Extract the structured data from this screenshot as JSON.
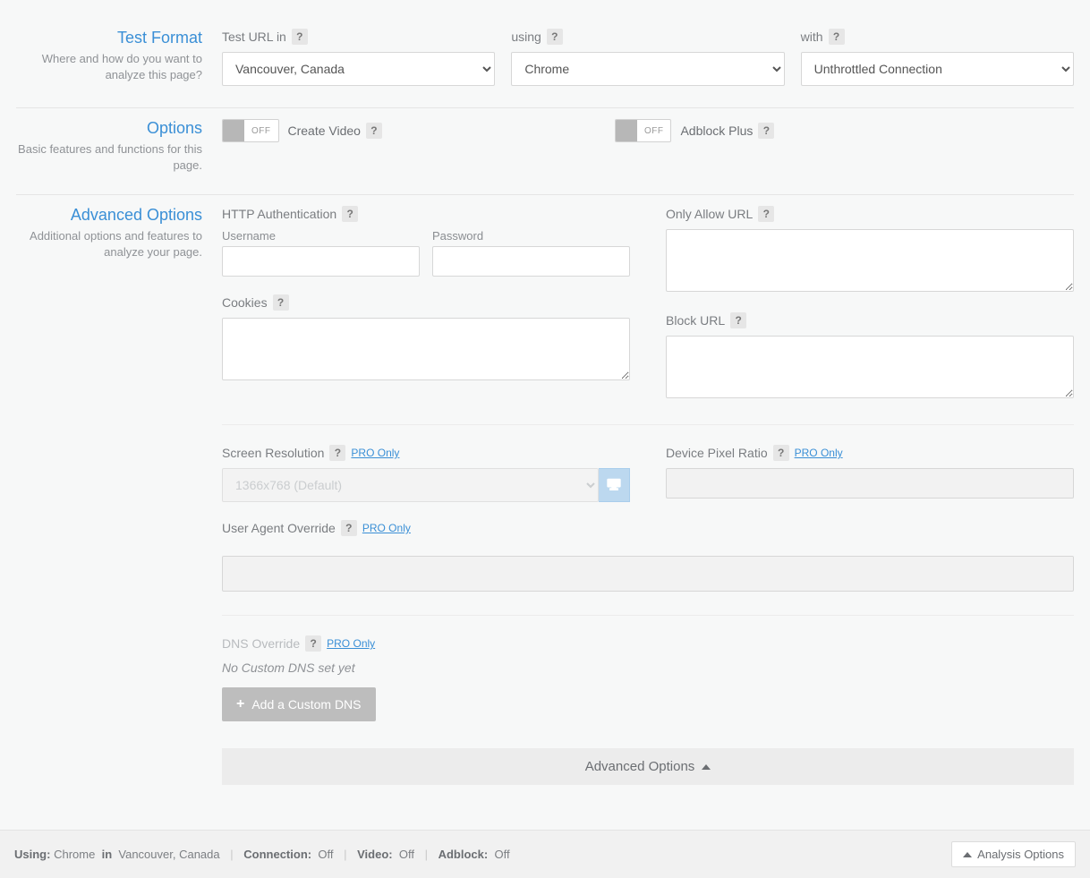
{
  "testFormat": {
    "title": "Test Format",
    "description": "Where and how do you want to analyze this page?",
    "testUrlLabel": "Test URL in",
    "usingLabel": "using",
    "withLabel": "with",
    "location": "Vancouver, Canada",
    "browser": "Chrome",
    "connection": "Unthrottled Connection"
  },
  "options": {
    "title": "Options",
    "description": "Basic features and functions for this page.",
    "offText": "OFF",
    "createVideoLabel": "Create Video",
    "adblockLabel": "Adblock Plus"
  },
  "advanced": {
    "title": "Advanced Options",
    "description": "Additional options and features to analyze your page.",
    "httpAuthLabel": "HTTP Authentication",
    "usernameLabel": "Username",
    "passwordLabel": "Password",
    "cookiesLabel": "Cookies",
    "onlyAllowLabel": "Only Allow URL",
    "blockUrlLabel": "Block URL",
    "screenResLabel": "Screen Resolution",
    "screenResValue": "1366x768 (Default)",
    "devicePixelLabel": "Device Pixel Ratio",
    "userAgentLabel": "User Agent Override",
    "proOnly": "PRO Only",
    "dnsOverrideLabel": "DNS Override",
    "noCustomDns": "No Custom DNS set yet",
    "addCustomDns": "Add a Custom DNS",
    "collapseLabel": "Advanced Options"
  },
  "footer": {
    "usingKey": "Using:",
    "browser": "Chrome",
    "inWord": "in",
    "location": "Vancouver, Canada",
    "connectionKey": "Connection:",
    "connectionVal": "Off",
    "videoKey": "Video:",
    "videoVal": "Off",
    "adblockKey": "Adblock:",
    "adblockVal": "Off",
    "analysisOptions": "Analysis Options"
  },
  "helpGlyph": "?"
}
